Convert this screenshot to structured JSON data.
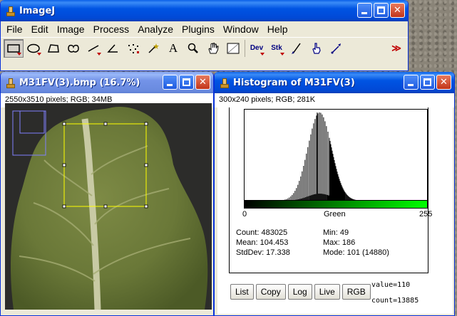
{
  "main_window": {
    "title": "ImageJ",
    "menus": [
      "File",
      "Edit",
      "Image",
      "Process",
      "Analyze",
      "Plugins",
      "Window",
      "Help"
    ],
    "tools": [
      {
        "name": "rectangle-tool",
        "glyph": "▭"
      },
      {
        "name": "oval-tool",
        "glyph": "◯"
      },
      {
        "name": "polygon-tool",
        "glyph": "⏢"
      },
      {
        "name": "freehand-tool",
        "glyph": "♡"
      },
      {
        "name": "line-tool",
        "glyph": "╱"
      },
      {
        "name": "angle-tool",
        "glyph": "∠"
      },
      {
        "name": "point-tool",
        "glyph": "✣"
      },
      {
        "name": "wand-tool",
        "glyph": "⚡"
      },
      {
        "name": "text-tool",
        "glyph": "A"
      },
      {
        "name": "magnifier-tool",
        "glyph": "🔍"
      },
      {
        "name": "hand-tool",
        "glyph": "✋"
      },
      {
        "name": "color-picker-tool",
        "glyph": "▨"
      },
      {
        "name": "dev-menu",
        "glyph": "Dev"
      },
      {
        "name": "stk-menu",
        "glyph": "Stk"
      },
      {
        "name": "brush-tool",
        "glyph": "✎"
      },
      {
        "name": "hand-touch-tool",
        "glyph": "☝"
      },
      {
        "name": "pipette-tool",
        "glyph": "⤤"
      },
      {
        "name": "more-tools",
        "glyph": "≫"
      }
    ]
  },
  "image_window": {
    "title": "M31FV(3).bmp (16.7%)",
    "info": "2550x3510 pixels; RGB; 34MB"
  },
  "histogram_window": {
    "title": "Histogram of M31FV(3)",
    "info": "300x240 pixels; RGB; 281K",
    "axis_min": "0",
    "axis_max": "255",
    "channel_label": "Green",
    "stats": {
      "count": "Count: 483025",
      "mean": "Mean: 104.453",
      "stddev": "StdDev: 17.338",
      "min": "Min: 49",
      "max": "Max: 186",
      "mode": "Mode: 101 (14880)"
    },
    "buttons": [
      "List",
      "Copy",
      "Log",
      "Live",
      "RGB"
    ],
    "value_readout": "value=110",
    "count_readout": "count=13885"
  },
  "chart_data": {
    "type": "bar",
    "title": "",
    "xlabel": "Green",
    "ylabel": "",
    "xlim": [
      0,
      255
    ],
    "stats": {
      "count": 483025,
      "mean": 104.453,
      "stddev": 17.338,
      "min": 49,
      "max": 186,
      "mode": 101,
      "mode_count": 14880
    },
    "distribution": "approximately normal, comb-like bins between 49 and 186, peak near 101"
  },
  "colors": {
    "title_active": "#0054e3",
    "window_bg": "#ece9d8",
    "lut_start": "#000000",
    "lut_end": "#00ff00",
    "roi": "#ffff00",
    "leaf": "#6f7d3c"
  }
}
